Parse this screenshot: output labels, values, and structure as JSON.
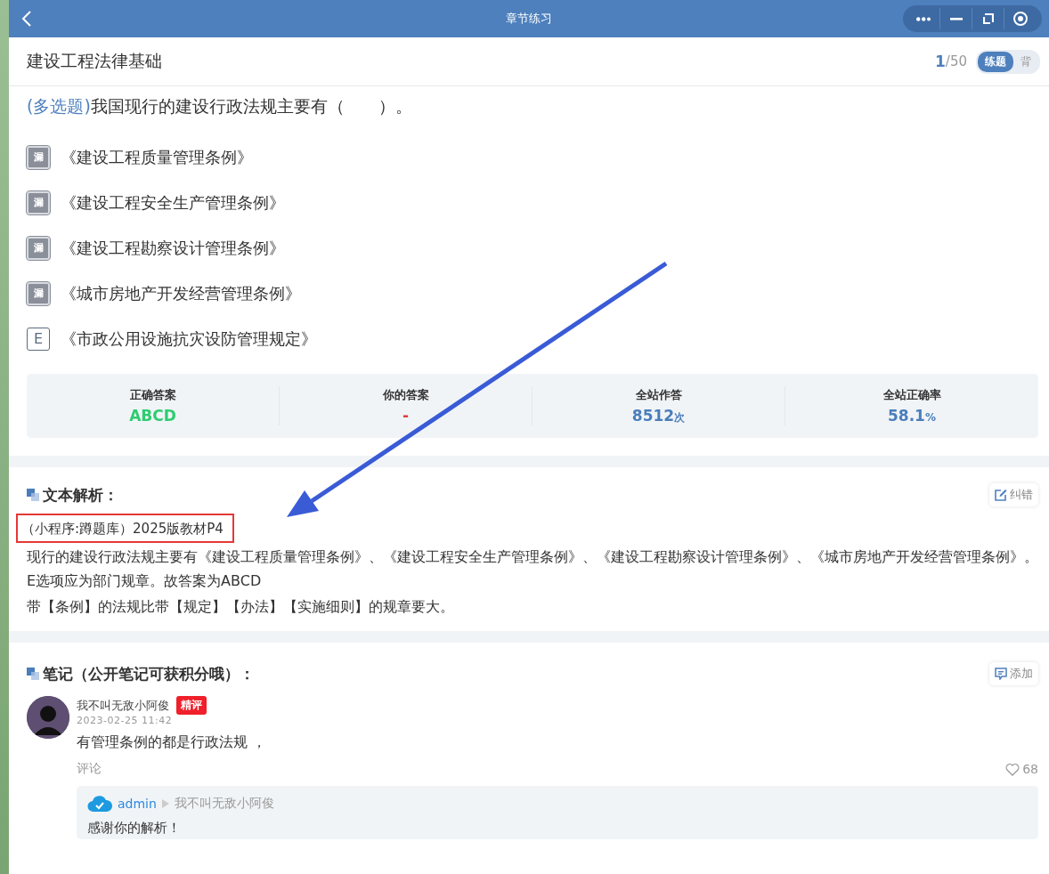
{
  "window": {
    "title": "章节练习"
  },
  "subject": {
    "title": "建设工程法律基础",
    "current": "1",
    "total": "/50",
    "modes": [
      {
        "label": "练题",
        "selected": true
      },
      {
        "label": "背",
        "selected": false
      }
    ]
  },
  "question": {
    "type_label": "(多选题)",
    "text": "我国现行的建设行政法规主要有（　　）。"
  },
  "options": [
    {
      "kind": "missed",
      "mark": "漏",
      "text": "《建设工程质量管理条例》"
    },
    {
      "kind": "missed",
      "mark": "漏",
      "text": "《建设工程安全生产管理条例》"
    },
    {
      "kind": "missed",
      "mark": "漏",
      "text": "《建设工程勘察设计管理条例》"
    },
    {
      "kind": "missed",
      "mark": "漏",
      "text": "《城市房地产开发经营管理条例》"
    },
    {
      "kind": "plain",
      "mark": "E",
      "text": "《市政公用设施抗灾设防管理规定》"
    }
  ],
  "stats": [
    {
      "label": "正确答案",
      "value": "ABCD",
      "color": "#2ecc71"
    },
    {
      "label": "你的答案",
      "value": "-",
      "color": "#e03c3c"
    },
    {
      "label": "全站作答",
      "value": "8512",
      "unit": "次",
      "color": "#4a7ebb"
    },
    {
      "label": "全站正确率",
      "value": "58.1",
      "unit": "%",
      "color": "#4a7ebb"
    }
  ],
  "analysis": {
    "title": "文本解析：",
    "action": "纠错",
    "source": "（小程序:蹲题库）2025版教材P4",
    "paragraphs": [
      "现行的建设行政法规主要有《建设工程质量管理条例》、《建设工程安全生产管理条例》、《建设工程勘察设计管理条例》、《城市房地产开发经营管理条例》。E选项应为部门规章。故答案为ABCD",
      "带【条例】的法规比带【规定】【办法】【实施细则】的规章要大。"
    ]
  },
  "notes": {
    "title": "笔记（公开笔记可获积分哦）：",
    "action": "添加",
    "items": [
      {
        "author": "我不叫无敌小阿俊",
        "badge": "精评",
        "time": "2023-02-25 11:42",
        "text": "有管理条例的都是行政法规 ，",
        "comment": "评论",
        "likes": "68",
        "replies": [
          {
            "author": "admin",
            "to": "我不叫无敌小阿俊",
            "text": "感谢你的解析！"
          }
        ]
      }
    ]
  }
}
